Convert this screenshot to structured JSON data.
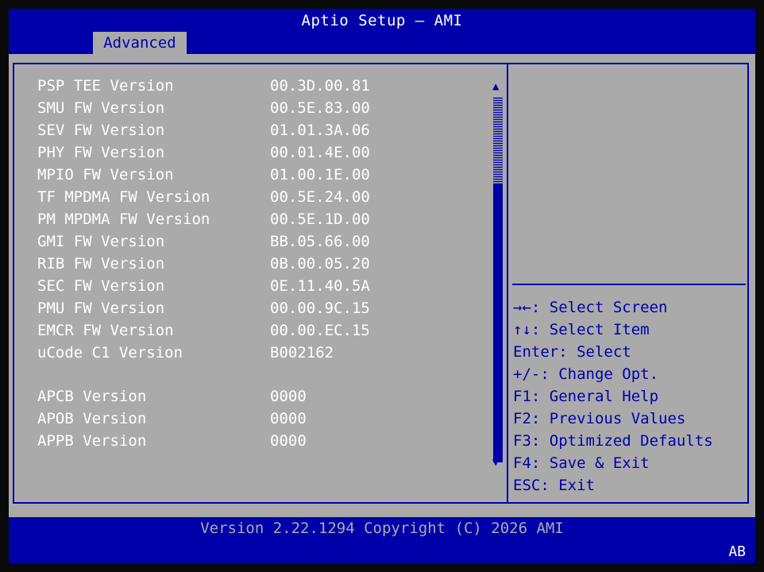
{
  "header": {
    "title": "Aptio Setup – AMI",
    "tab": "Advanced"
  },
  "items": [
    {
      "label": "PSP TEE Version",
      "value": "00.3D.00.81"
    },
    {
      "label": "SMU FW Version",
      "value": "00.5E.83.00"
    },
    {
      "label": "SEV FW Version",
      "value": "01.01.3A.06"
    },
    {
      "label": "PHY FW Version",
      "value": "00.01.4E.00"
    },
    {
      "label": "MPIO FW Version",
      "value": "01.00.1E.00"
    },
    {
      "label": "TF MPDMA FW Version",
      "value": "00.5E.24.00"
    },
    {
      "label": "PM MPDMA FW Version",
      "value": "00.5E.1D.00"
    },
    {
      "label": "GMI FW Version",
      "value": "BB.05.66.00"
    },
    {
      "label": "RIB FW Version",
      "value": "0B.00.05.20"
    },
    {
      "label": "SEC FW Version",
      "value": "0E.11.40.5A"
    },
    {
      "label": "PMU FW Version",
      "value": "00.00.9C.15"
    },
    {
      "label": "EMCR FW Version",
      "value": "00.00.EC.15"
    },
    {
      "label": "uCode C1 Version",
      "value": "B002162"
    },
    {
      "label": "APCB Version",
      "value": "0000"
    },
    {
      "label": "APOB Version",
      "value": "0000"
    },
    {
      "label": "APPB Version",
      "value": "0000"
    }
  ],
  "scroll": {
    "up_icon": "arrow-up",
    "down_icon": "arrow-down"
  },
  "help": [
    "→←: Select Screen",
    "↑↓: Select Item",
    "Enter: Select",
    "+/-: Change Opt.",
    "F1: General Help",
    "F2: Previous Values",
    "F3: Optimized Defaults",
    "F4: Save & Exit",
    "ESC: Exit"
  ],
  "footer": {
    "version": "Version 2.22.1294 Copyright (C) 2026 AMI",
    "code": "AB"
  },
  "colors": {
    "blue": "#0000aa",
    "gray": "#aaaaaa",
    "white": "#ffffff",
    "border": "#0a0a0a"
  }
}
